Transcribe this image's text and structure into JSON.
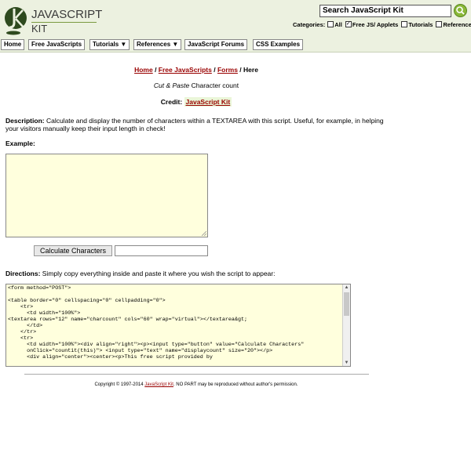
{
  "header": {
    "logo_line1": "JAVASCRIPT",
    "logo_line2": "KIT",
    "search_value": "Search JavaScript Kit",
    "categories_label": "Categories:",
    "categories": [
      {
        "label": "All",
        "checked": false
      },
      {
        "label": "Free JS/ Applets",
        "checked": true
      },
      {
        "label": "Tutorials",
        "checked": false
      },
      {
        "label": "References",
        "checked": false
      }
    ]
  },
  "nav": {
    "items": [
      {
        "label": "Home"
      },
      {
        "label": "Free JavaScripts"
      },
      {
        "label": "Tutorials ▼"
      },
      {
        "label": "References ▼"
      },
      {
        "label": "JavaScript Forums"
      },
      {
        "label": "CSS Examples"
      }
    ]
  },
  "breadcrumb": {
    "home": "Home",
    "sep": " / ",
    "free": "Free JavaScripts",
    "forms": "Forms",
    "here": "Here"
  },
  "script_title": {
    "italic": "Cut & Paste",
    "rest": " Character count"
  },
  "credit": {
    "label": "Credit: ",
    "link": "JavaScript Kit"
  },
  "description": {
    "label": "Description:",
    "text": " Calculate and display the number of characters within a TEXTAREA with this script. Useful, for example, in helping your visitors manually keep their input length in check!"
  },
  "example": {
    "label": "Example:",
    "button": "Calculate Characters"
  },
  "directions": {
    "label": "Directions:",
    "text": " Simply copy everything inside and paste it where you wish the script to appear:"
  },
  "code": "<form method=\"POST\">\n\n<table border=\"0\" cellspacing=\"0\" cellpadding=\"0\">\n    <tr>\n      <td width=\"100%\">\n<textarea rows=\"12\" name=\"charcount\" cols=\"60\" wrap=\"virtual\"></textarea&gt;\n      </td>\n    </tr>\n    <tr>\n      <td width=\"100%\"><div align=\"right\"><p><input type=\"button\" value=\"Calculate Characters\"\n      onClick=\"countit(this)\"> <input type=\"text\" name=\"displaycount\" size=\"20\"></p>\n      <div align=\"center\"><center><p>This free script provided by",
  "footer": {
    "pre": "Copyright © 1997-2014 ",
    "link": "JavaScript Kit",
    "post": ". NO PART may be reproduced without author's permission."
  }
}
